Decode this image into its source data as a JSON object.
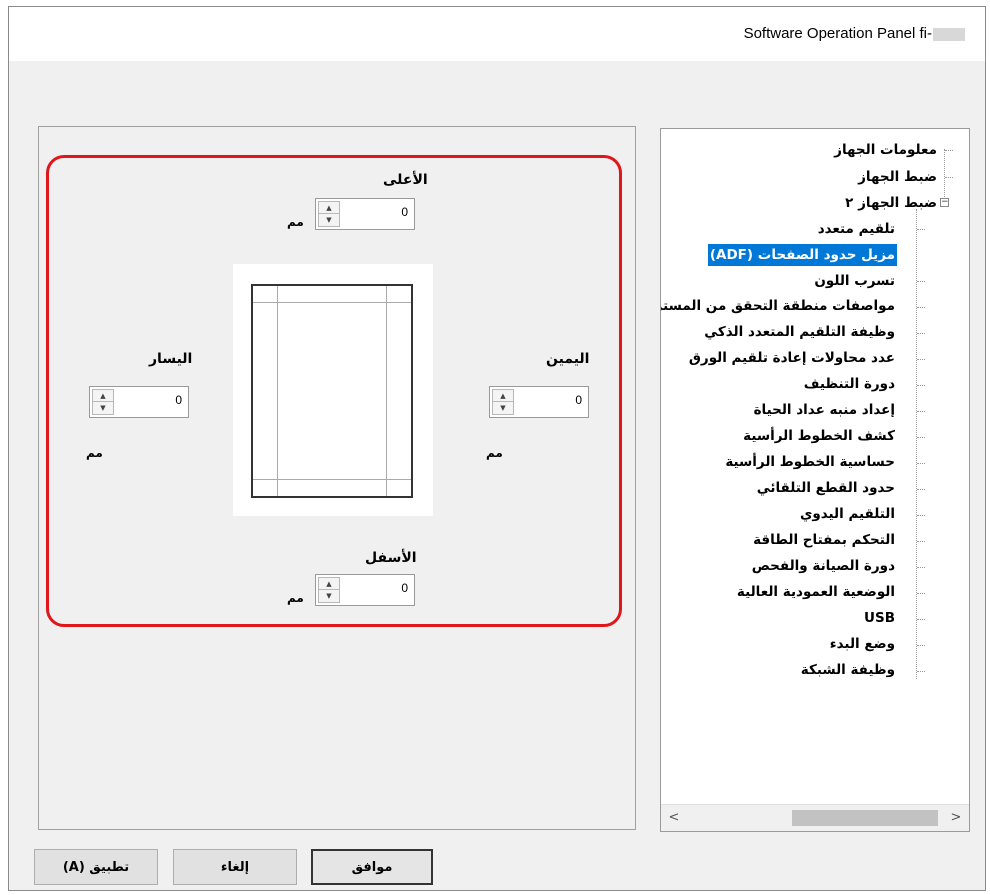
{
  "window": {
    "title": "Software Operation Panel fi-"
  },
  "settings": {
    "top_label": "الأعلى",
    "bottom_label": "الأسفل",
    "left_label": "اليسار",
    "right_label": "اليمين",
    "unit": "مم",
    "top_value": "0",
    "bottom_value": "0",
    "left_value": "0",
    "right_value": "0"
  },
  "tree": {
    "items": [
      {
        "label": "معلومات الجهاز"
      },
      {
        "label": "ضبط الجهاز"
      },
      {
        "label": "ضبط الجهاز ٢"
      },
      {
        "label": "تلقيم متعدد"
      },
      {
        "label": "مزيل حدود الصفحات (ADF)"
      },
      {
        "label": "تسرب اللون"
      },
      {
        "label": "مواصفات منطقة التحقق من المستن"
      },
      {
        "label": "وظيفة التلقيم المتعدد الذكي"
      },
      {
        "label": "عدد محاولات إعادة تلقيم الورق"
      },
      {
        "label": "دورة التنظيف"
      },
      {
        "label": "إعداد منبه عداد الحياة"
      },
      {
        "label": "كشف الخطوط الرأسية"
      },
      {
        "label": "حساسية الخطوط الرأسية"
      },
      {
        "label": "حدود القطع التلقائي"
      },
      {
        "label": "التلقيم اليدوي"
      },
      {
        "label": "التحكم بمفتاح الطاقة"
      },
      {
        "label": "دورة الصيانة والفحص"
      },
      {
        "label": "الوضعية العمودية العالية"
      },
      {
        "label": "USB"
      },
      {
        "label": "وضع البدء"
      },
      {
        "label": "وظيفة الشبكة"
      }
    ],
    "selected_index": 4
  },
  "buttons": {
    "ok": "موافق",
    "cancel": "إلغاء",
    "apply": "تطبيق (A)"
  },
  "icons": {
    "expander": "collapse-minus-icon",
    "scroll_left": "chevron-left-icon",
    "scroll_right": "chevron-right-icon",
    "spin": "spin-up-down-icon",
    "dropdown": "dropdown-arrow-icon"
  },
  "colors": {
    "highlight": "#e0161b",
    "selection": "#0078d7"
  }
}
